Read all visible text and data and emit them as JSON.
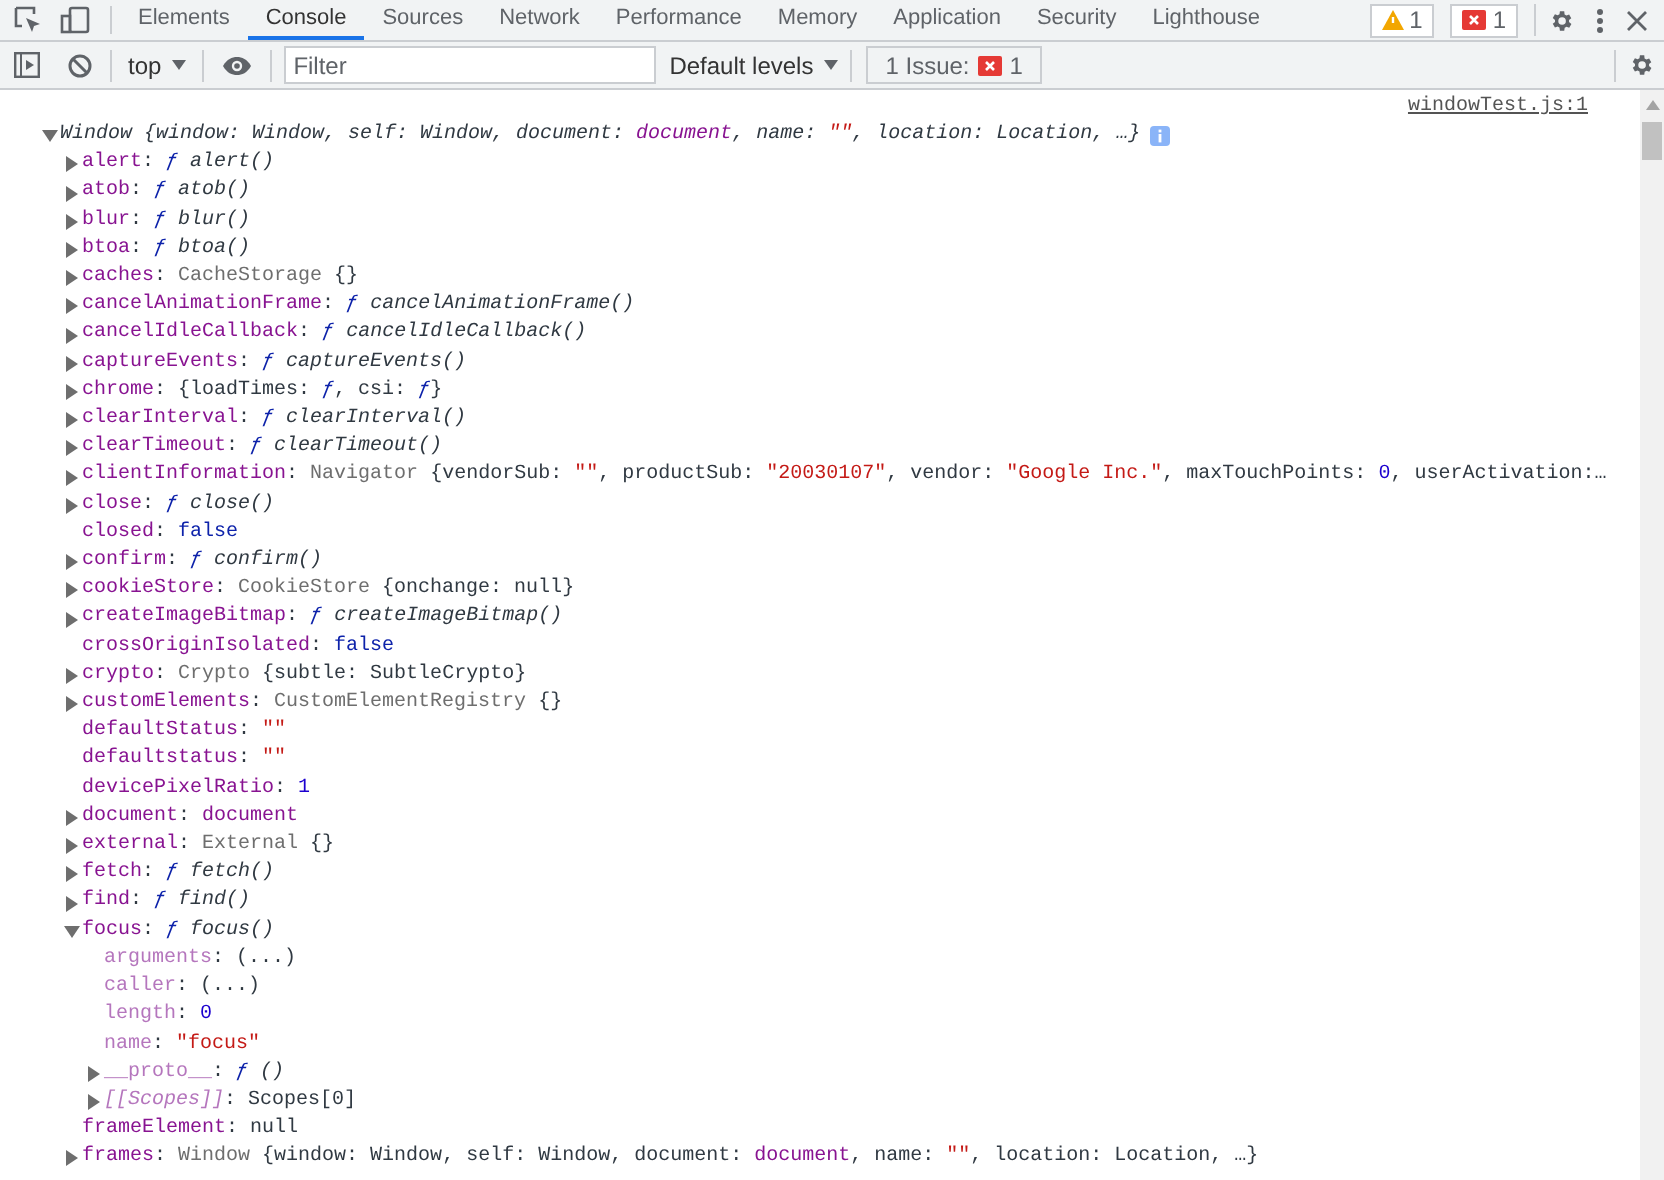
{
  "tabs": [
    {
      "label": "Elements",
      "selected": false
    },
    {
      "label": "Console",
      "selected": true
    },
    {
      "label": "Sources",
      "selected": false
    },
    {
      "label": "Network",
      "selected": false
    },
    {
      "label": "Performance",
      "selected": false
    },
    {
      "label": "Memory",
      "selected": false
    },
    {
      "label": "Application",
      "selected": false
    },
    {
      "label": "Security",
      "selected": false
    },
    {
      "label": "Lighthouse",
      "selected": false
    }
  ],
  "badges": [
    {
      "kind": "warning",
      "count": "1"
    },
    {
      "kind": "error",
      "count": "1"
    }
  ],
  "toolbar": {
    "context": "top",
    "filter": {
      "placeholder": "Filter"
    },
    "levels": "Default levels",
    "issues": {
      "label": "1 Issue:",
      "count": "1"
    }
  },
  "console": {
    "source_link": "windowTest.js:1",
    "root": {
      "expanded": true,
      "tokens": [
        {
          "kind": "punct",
          "text": "Window {window: Window, self: Window, document: "
        },
        {
          "kind": "node",
          "text": "document"
        },
        {
          "kind": "punct",
          "text": ", name: "
        },
        {
          "kind": "str",
          "text": "\"\""
        },
        {
          "kind": "punct",
          "text": ", location: Location, …}"
        }
      ]
    },
    "lines": [
      {
        "expanded": false,
        "tokens": [
          {
            "kind": "key",
            "text": "alert"
          },
          {
            "kind": "punct",
            "text": ": "
          },
          {
            "kind": "fn",
            "text": "ƒ "
          },
          {
            "kind": "sig",
            "text": "alert()"
          }
        ]
      },
      {
        "expanded": false,
        "tokens": [
          {
            "kind": "key",
            "text": "atob"
          },
          {
            "kind": "punct",
            "text": ": "
          },
          {
            "kind": "fn",
            "text": "ƒ "
          },
          {
            "kind": "sig",
            "text": "atob()"
          }
        ]
      },
      {
        "expanded": false,
        "tokens": [
          {
            "kind": "key",
            "text": "blur"
          },
          {
            "kind": "punct",
            "text": ": "
          },
          {
            "kind": "fn",
            "text": "ƒ "
          },
          {
            "kind": "sig",
            "text": "blur()"
          }
        ]
      },
      {
        "expanded": false,
        "tokens": [
          {
            "kind": "key",
            "text": "btoa"
          },
          {
            "kind": "punct",
            "text": ": "
          },
          {
            "kind": "fn",
            "text": "ƒ "
          },
          {
            "kind": "sig",
            "text": "btoa()"
          }
        ]
      },
      {
        "expanded": false,
        "tokens": [
          {
            "kind": "key",
            "text": "caches"
          },
          {
            "kind": "punct",
            "text": ": "
          },
          {
            "kind": "class",
            "text": "CacheStorage"
          },
          {
            "kind": "punct",
            "text": " {}"
          }
        ]
      },
      {
        "expanded": false,
        "tokens": [
          {
            "kind": "key",
            "text": "cancelAnimationFrame"
          },
          {
            "kind": "punct",
            "text": ": "
          },
          {
            "kind": "fn",
            "text": "ƒ "
          },
          {
            "kind": "sig",
            "text": "cancelAnimationFrame()"
          }
        ]
      },
      {
        "expanded": false,
        "tokens": [
          {
            "kind": "key",
            "text": "cancelIdleCallback"
          },
          {
            "kind": "punct",
            "text": ": "
          },
          {
            "kind": "fn",
            "text": "ƒ "
          },
          {
            "kind": "sig",
            "text": "cancelIdleCallback()"
          }
        ]
      },
      {
        "expanded": false,
        "tokens": [
          {
            "kind": "key",
            "text": "captureEvents"
          },
          {
            "kind": "punct",
            "text": ": "
          },
          {
            "kind": "fn",
            "text": "ƒ "
          },
          {
            "kind": "sig",
            "text": "captureEvents()"
          }
        ]
      },
      {
        "expanded": false,
        "tokens": [
          {
            "kind": "key",
            "text": "chrome"
          },
          {
            "kind": "punct",
            "text": ": {loadTimes: "
          },
          {
            "kind": "fn",
            "text": "ƒ"
          },
          {
            "kind": "punct",
            "text": ", csi: "
          },
          {
            "kind": "fn",
            "text": "ƒ"
          },
          {
            "kind": "punct",
            "text": "}"
          }
        ]
      },
      {
        "expanded": false,
        "tokens": [
          {
            "kind": "key",
            "text": "clearInterval"
          },
          {
            "kind": "punct",
            "text": ": "
          },
          {
            "kind": "fn",
            "text": "ƒ "
          },
          {
            "kind": "sig",
            "text": "clearInterval()"
          }
        ]
      },
      {
        "expanded": false,
        "tokens": [
          {
            "kind": "key",
            "text": "clearTimeout"
          },
          {
            "kind": "punct",
            "text": ": "
          },
          {
            "kind": "fn",
            "text": "ƒ "
          },
          {
            "kind": "sig",
            "text": "clearTimeout()"
          }
        ]
      },
      {
        "expanded": false,
        "tokens": [
          {
            "kind": "key",
            "text": "clientInformation"
          },
          {
            "kind": "punct",
            "text": ": "
          },
          {
            "kind": "class",
            "text": "Navigator"
          },
          {
            "kind": "punct",
            "text": " {vendorSub: "
          },
          {
            "kind": "str",
            "text": "\"\""
          },
          {
            "kind": "punct",
            "text": ", productSub: "
          },
          {
            "kind": "str",
            "text": "\"20030107\""
          },
          {
            "kind": "punct",
            "text": ", vendor: "
          },
          {
            "kind": "str",
            "text": "\"Google Inc.\""
          },
          {
            "kind": "punct",
            "text": ", maxTouchPoints: "
          },
          {
            "kind": "num",
            "text": "0"
          },
          {
            "kind": "punct",
            "text": ", userActivation:…"
          }
        ]
      },
      {
        "expanded": false,
        "tokens": [
          {
            "kind": "key",
            "text": "close"
          },
          {
            "kind": "punct",
            "text": ": "
          },
          {
            "kind": "fn",
            "text": "ƒ "
          },
          {
            "kind": "sig",
            "text": "close()"
          }
        ]
      },
      {
        "tokens": [
          {
            "kind": "key",
            "text": "closed"
          },
          {
            "kind": "punct",
            "text": ": "
          },
          {
            "kind": "bool",
            "text": "false"
          }
        ]
      },
      {
        "expanded": false,
        "tokens": [
          {
            "kind": "key",
            "text": "confirm"
          },
          {
            "kind": "punct",
            "text": ": "
          },
          {
            "kind": "fn",
            "text": "ƒ "
          },
          {
            "kind": "sig",
            "text": "confirm()"
          }
        ]
      },
      {
        "expanded": false,
        "tokens": [
          {
            "kind": "key",
            "text": "cookieStore"
          },
          {
            "kind": "punct",
            "text": ": "
          },
          {
            "kind": "class",
            "text": "CookieStore"
          },
          {
            "kind": "punct",
            "text": " {onchange: null}"
          }
        ]
      },
      {
        "expanded": false,
        "tokens": [
          {
            "kind": "key",
            "text": "createImageBitmap"
          },
          {
            "kind": "punct",
            "text": ": "
          },
          {
            "kind": "fn",
            "text": "ƒ "
          },
          {
            "kind": "sig",
            "text": "createImageBitmap()"
          }
        ]
      },
      {
        "tokens": [
          {
            "kind": "key",
            "text": "crossOriginIsolated"
          },
          {
            "kind": "punct",
            "text": ": "
          },
          {
            "kind": "bool",
            "text": "false"
          }
        ]
      },
      {
        "expanded": false,
        "tokens": [
          {
            "kind": "key",
            "text": "crypto"
          },
          {
            "kind": "punct",
            "text": ": "
          },
          {
            "kind": "class",
            "text": "Crypto"
          },
          {
            "kind": "punct",
            "text": " {subtle: SubtleCrypto}"
          }
        ]
      },
      {
        "expanded": false,
        "tokens": [
          {
            "kind": "key",
            "text": "customElements"
          },
          {
            "kind": "punct",
            "text": ": "
          },
          {
            "kind": "class",
            "text": "CustomElementRegistry"
          },
          {
            "kind": "punct",
            "text": " {}"
          }
        ]
      },
      {
        "tokens": [
          {
            "kind": "key",
            "text": "defaultStatus"
          },
          {
            "kind": "punct",
            "text": ": "
          },
          {
            "kind": "str",
            "text": "\"\""
          }
        ]
      },
      {
        "tokens": [
          {
            "kind": "key",
            "text": "defaultstatus"
          },
          {
            "kind": "punct",
            "text": ": "
          },
          {
            "kind": "str",
            "text": "\"\""
          }
        ]
      },
      {
        "tokens": [
          {
            "kind": "key",
            "text": "devicePixelRatio"
          },
          {
            "kind": "punct",
            "text": ": "
          },
          {
            "kind": "num",
            "text": "1"
          }
        ]
      },
      {
        "expanded": false,
        "tokens": [
          {
            "kind": "key",
            "text": "document"
          },
          {
            "kind": "punct",
            "text": ": "
          },
          {
            "kind": "node",
            "text": "document"
          }
        ]
      },
      {
        "expanded": false,
        "tokens": [
          {
            "kind": "key",
            "text": "external"
          },
          {
            "kind": "punct",
            "text": ": "
          },
          {
            "kind": "class",
            "text": "External"
          },
          {
            "kind": "punct",
            "text": " {}"
          }
        ]
      },
      {
        "expanded": false,
        "tokens": [
          {
            "kind": "key",
            "text": "fetch"
          },
          {
            "kind": "punct",
            "text": ": "
          },
          {
            "kind": "fn",
            "text": "ƒ "
          },
          {
            "kind": "sig",
            "text": "fetch()"
          }
        ]
      },
      {
        "expanded": false,
        "tokens": [
          {
            "kind": "key",
            "text": "find"
          },
          {
            "kind": "punct",
            "text": ": "
          },
          {
            "kind": "fn",
            "text": "ƒ "
          },
          {
            "kind": "sig",
            "text": "find()"
          }
        ]
      },
      {
        "expanded": true,
        "tokens": [
          {
            "kind": "key",
            "text": "focus"
          },
          {
            "kind": "punct",
            "text": ": "
          },
          {
            "kind": "fn",
            "text": "ƒ "
          },
          {
            "kind": "sig",
            "text": "focus()"
          }
        ],
        "children": [
          {
            "tokens": [
              {
                "kind": "dim_key",
                "text": "arguments"
              },
              {
                "kind": "punct",
                "text": ": (...)"
              }
            ]
          },
          {
            "tokens": [
              {
                "kind": "dim_key",
                "text": "caller"
              },
              {
                "kind": "punct",
                "text": ": (...)"
              }
            ]
          },
          {
            "tokens": [
              {
                "kind": "dim_key",
                "text": "length"
              },
              {
                "kind": "punct",
                "text": ": "
              },
              {
                "kind": "num",
                "text": "0"
              }
            ]
          },
          {
            "tokens": [
              {
                "kind": "dim_key",
                "text": "name"
              },
              {
                "kind": "punct",
                "text": ": "
              },
              {
                "kind": "str",
                "text": "\"focus\""
              }
            ]
          },
          {
            "expanded": false,
            "tokens": [
              {
                "kind": "dim_key",
                "text": "__proto__"
              },
              {
                "kind": "punct",
                "text": ": "
              },
              {
                "kind": "fn",
                "text": "ƒ "
              },
              {
                "kind": "sig",
                "text": "()"
              }
            ]
          },
          {
            "expanded": false,
            "tokens": [
              {
                "kind": "internal_key",
                "text": "[[Scopes]]"
              },
              {
                "kind": "punct",
                "text": ": Scopes[0]"
              }
            ]
          }
        ]
      },
      {
        "tokens": [
          {
            "kind": "key",
            "text": "frameElement"
          },
          {
            "kind": "punct",
            "text": ": null"
          }
        ]
      },
      {
        "expanded": false,
        "tokens": [
          {
            "kind": "key",
            "text": "frames"
          },
          {
            "kind": "punct",
            "text": ": "
          },
          {
            "kind": "class",
            "text": "Window"
          },
          {
            "kind": "punct",
            "text": " {window: Window, self: Window, document: "
          },
          {
            "kind": "node",
            "text": "document"
          },
          {
            "kind": "punct",
            "text": ", name: "
          },
          {
            "kind": "str",
            "text": "\"\""
          },
          {
            "kind": "punct",
            "text": ", location: Location, …}"
          }
        ]
      }
    ]
  }
}
